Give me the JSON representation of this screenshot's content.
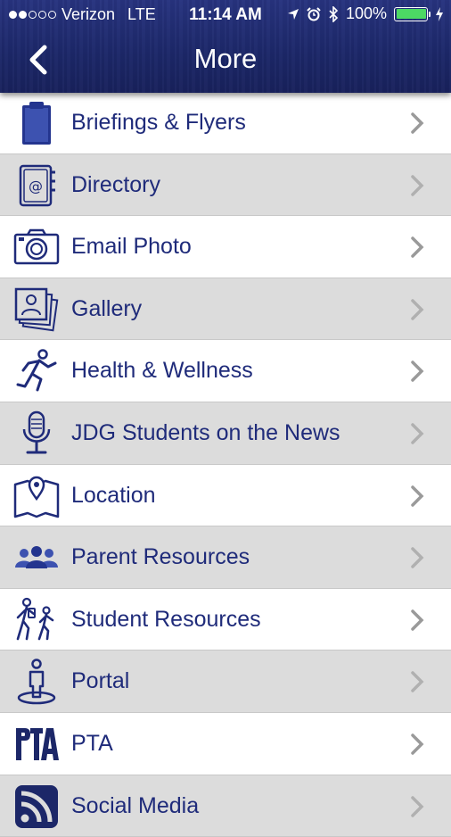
{
  "status_bar": {
    "carrier": "Verizon",
    "network": "LTE",
    "time": "11:14 AM",
    "battery": "100%",
    "signal_dots_filled": 2,
    "signal_dots_total": 5
  },
  "nav": {
    "title": "More"
  },
  "menu": {
    "items": [
      {
        "label": "Briefings & Flyers",
        "icon": "clipboard-icon"
      },
      {
        "label": "Directory",
        "icon": "address-book-icon"
      },
      {
        "label": "Email Photo",
        "icon": "camera-icon"
      },
      {
        "label": "Gallery",
        "icon": "photo-stack-icon"
      },
      {
        "label": "Health & Wellness",
        "icon": "runner-icon"
      },
      {
        "label": "JDG Students on the News",
        "icon": "microphone-icon"
      },
      {
        "label": "Location",
        "icon": "map-pin-icon"
      },
      {
        "label": "Parent Resources",
        "icon": "group-icon"
      },
      {
        "label": "Student Resources",
        "icon": "students-walking-icon"
      },
      {
        "label": "Portal",
        "icon": "person-portal-icon"
      },
      {
        "label": "PTA",
        "icon": "pta-logo-icon"
      },
      {
        "label": "Social Media",
        "icon": "rss-icon"
      }
    ]
  },
  "colors": {
    "nav_bg": "#1c2768",
    "label": "#1f2b7a",
    "icon": "#1f2b7a",
    "row_alt": "#dcdcdc",
    "chevron": "#9a9a9a"
  }
}
